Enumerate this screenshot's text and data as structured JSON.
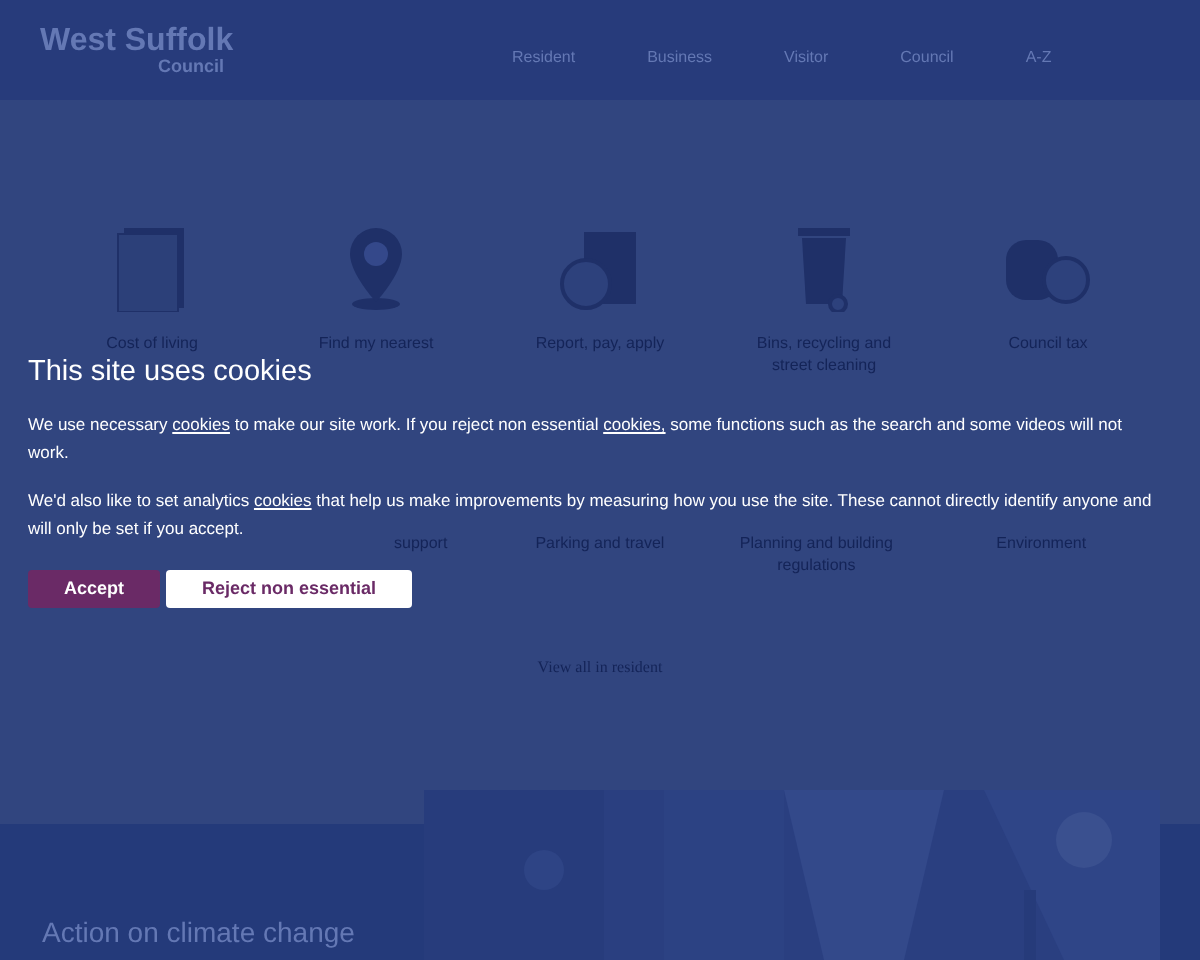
{
  "header": {
    "logo": {
      "name": "West Suffolk",
      "sub": "Council"
    },
    "nav": [
      {
        "label": "Resident"
      },
      {
        "label": "Business"
      },
      {
        "label": "Visitor"
      },
      {
        "label": "Council"
      },
      {
        "label": "A-Z"
      }
    ]
  },
  "tiles": [
    {
      "label": "Cost of living"
    },
    {
      "label": "Find my nearest"
    },
    {
      "label": "Report, pay, apply"
    },
    {
      "label": "Bins, recycling and street cleaning"
    },
    {
      "label": "Council tax"
    }
  ],
  "tiles_row_2": [
    {
      "label": "support"
    },
    {
      "label": "Parking and travel"
    },
    {
      "label": "Planning and building regulations"
    },
    {
      "label": "Environment"
    }
  ],
  "view_all": "View all in resident",
  "feature": {
    "title": "Action on climate change",
    "kind": "picture"
  },
  "cookie_banner": {
    "title": "This site uses cookies",
    "paragraphs": [
      [
        {
          "text": "We use necessary "
        },
        {
          "text": "cookies",
          "link": true
        },
        {
          "text": " to make our site work. If you reject non essential "
        },
        {
          "text": "cookies,",
          "link": true
        },
        {
          "text": " some functions such as the search and some videos will not work."
        }
      ],
      [
        {
          "text": "We'd also like to set analytics "
        },
        {
          "text": "cookies",
          "link": true
        },
        {
          "text": " that help us make improvements by measuring how you use the site. These cannot directly identify anyone and will only be set if you accept."
        }
      ]
    ],
    "buttons": [
      {
        "label": "Accept",
        "kind": "primary"
      },
      {
        "label": "Reject non essential",
        "kind": "secondary"
      }
    ]
  }
}
